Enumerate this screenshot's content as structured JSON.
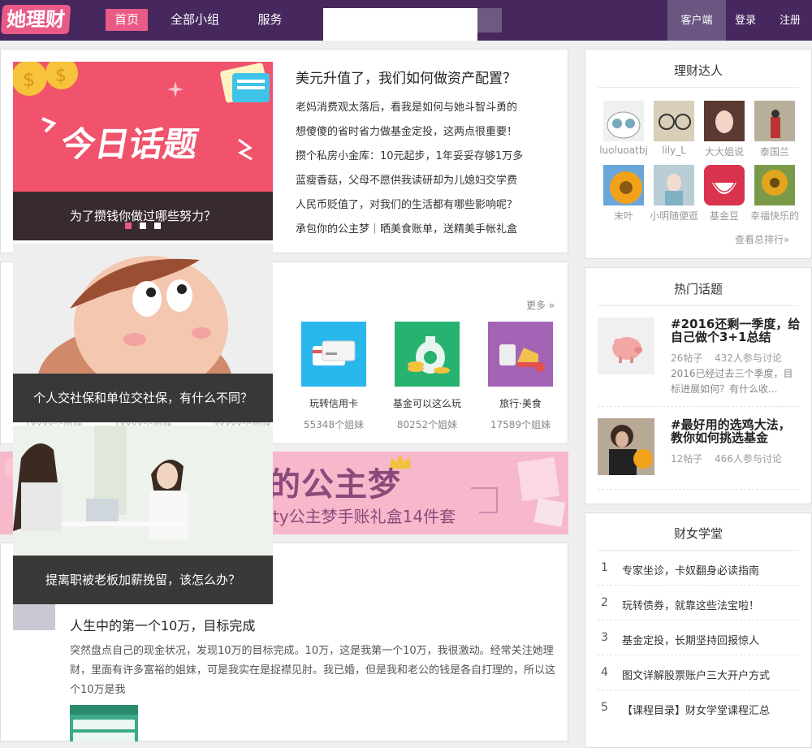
{
  "header": {
    "logo": "她理财",
    "nav": [
      "首页",
      "全部小组",
      "服务"
    ],
    "client": "客户端",
    "login": "登录",
    "register": "注册",
    "search_placeholder": ""
  },
  "topic": {
    "title": "美元升值了，我们如何做资产配置？",
    "lines": [
      "老妈消费观太落后，看我是如何与她斗智斗勇的",
      "想傻傻的省时省力做基金定投，这两点很重要！",
      "攒个私房小金库：10元起步，1年妥妥存够1万多",
      "蓝瘦香菇，父母不愿供我读研却为儿媳妇交学费",
      "人民币贬值了，对我们的生活都有哪些影响呢？",
      "承包你的公主梦｜晒美食账单，送精美手帐礼盒"
    ],
    "slide_banner_text": "今日话题",
    "slides": [
      "为了攒钱你做过哪些努力？",
      "个人交社保和单位交社保，有什么不同？",
      "提离职被老板加薪挽留，该怎么办？"
    ]
  },
  "groups": {
    "more": "更多 »",
    "ghost_counts": [
      "1xxxx个姐妹",
      "1xxxx个姐妹",
      "3xxxx个姐妹"
    ],
    "items": [
      {
        "name": "玩转信用卡",
        "count": "55348个姐妹",
        "color": "#29b7ec"
      },
      {
        "name": "基金可以这么玩",
        "count": "80252个姐妹",
        "color": "#27b36f"
      },
      {
        "name": "旅行·美食",
        "count": "17589个姐妹",
        "color": "#a464b5"
      }
    ]
  },
  "banner": {
    "title": "的公主梦",
    "subtitle": "ty公主梦手账礼盒14件套"
  },
  "article": {
    "title": "人生中的第一个10万，目标完成",
    "body": "突然盘点自己的现金状况，发现10万的目标完成。10万，这是我第一个10万，我很激动。经常关注她理财，里面有许多富裕的姐妹，可是我实在是捉襟见肘。我已婚，但是我和老公的钱是各自打理的，所以这个10万是我"
  },
  "stars": {
    "title": "理财达人",
    "more": "查看总排行»",
    "people": [
      {
        "name": "luoluoatbj",
        "color": "#e8e8e8"
      },
      {
        "name": "lily_L",
        "color": "#c9b79a"
      },
      {
        "name": "大大姐说",
        "color": "#5a3a32"
      },
      {
        "name": "泰国兰",
        "color": "#a9a08a"
      },
      {
        "name": "末叶",
        "color": "#f2a21a"
      },
      {
        "name": "小明随便逛",
        "color": "#9fb7c2"
      },
      {
        "name": "基金豆",
        "color": "#d9334e"
      },
      {
        "name": "幸福快乐的",
        "color": "#e2a51d"
      }
    ]
  },
  "hot": {
    "title": "热门话题",
    "items": [
      {
        "title": "#2016还剩一季度，给自己做个3+1总结",
        "posts": "26帖子",
        "people": "432人参与讨论",
        "desc": "2016已经过去三个季度，目标进展如何？有什么收..."
      },
      {
        "title": "#最好用的选鸡大法，教你如何挑选基金",
        "posts": "12帖子",
        "people": "466人参与讨论",
        "desc": ""
      }
    ]
  },
  "school": {
    "title": "财女学堂",
    "items": [
      "专家坐诊，卡奴翻身必读指南",
      "玩转债券，就靠这些法宝啦！",
      "基金定投，长期坚持回报惊人",
      "图文详解股票账户三大开户方式",
      "【课程目录】财女学堂课程汇总"
    ],
    "nums": [
      "1",
      "2",
      "3",
      "4",
      "5"
    ]
  }
}
